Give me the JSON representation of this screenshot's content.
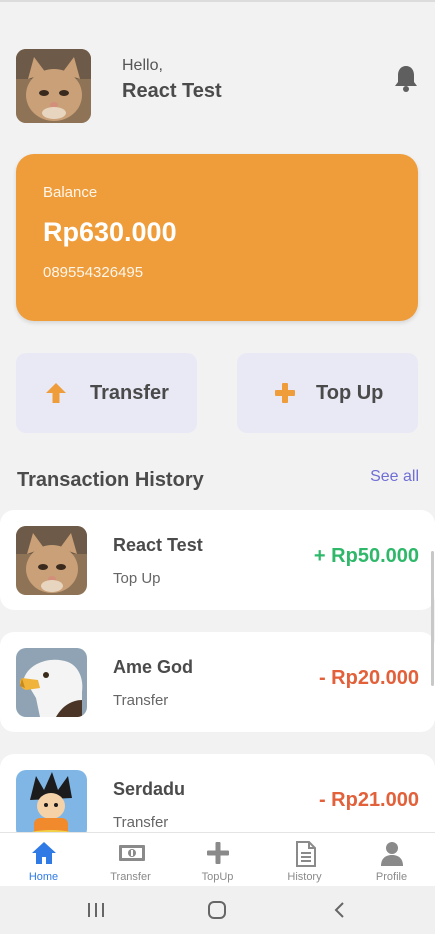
{
  "header": {
    "greeting": "Hello,",
    "name": "React Test",
    "avatar_icon": "cat-photo",
    "notification_icon": "bell-icon"
  },
  "balance": {
    "label": "Balance",
    "amount": "Rp630.000",
    "phone": "089554326495",
    "card_color": "#ef9c3b"
  },
  "actions": [
    {
      "label": "Transfer",
      "icon": "arrow-up-icon",
      "icon_color": "#ef9c3b"
    },
    {
      "label": "Top Up",
      "icon": "plus-icon",
      "icon_color": "#ef9c3b"
    }
  ],
  "history": {
    "title": "Transaction History",
    "see_all": "See all",
    "items": [
      {
        "name": "React Test",
        "type": "Top Up",
        "amount": "+ Rp50.000",
        "direction": "in",
        "avatar": "cat-photo"
      },
      {
        "name": "Ame God",
        "type": "Transfer",
        "amount": "- Rp20.000",
        "direction": "out",
        "avatar": "eagle-photo"
      },
      {
        "name": "Serdadu",
        "type": "Transfer",
        "amount": "- Rp21.000",
        "direction": "out",
        "avatar": "cartoon-boy-photo"
      }
    ]
  },
  "nav": {
    "active": "Home",
    "items": [
      {
        "label": "Home",
        "icon": "home-icon"
      },
      {
        "label": "Transfer",
        "icon": "money-icon"
      },
      {
        "label": "TopUp",
        "icon": "plus-icon"
      },
      {
        "label": "History",
        "icon": "document-icon"
      },
      {
        "label": "Profile",
        "icon": "user-icon"
      }
    ]
  },
  "colors": {
    "accent": "#ef9c3b",
    "positive": "#2fb86a",
    "negative": "#e2603a",
    "link": "#6f6fd6",
    "nav_active": "#2f7ae5"
  }
}
